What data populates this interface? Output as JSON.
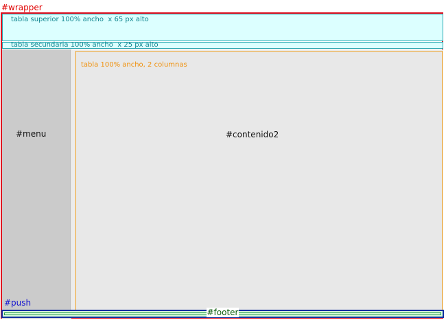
{
  "wrapper": {
    "label": "#wrapper"
  },
  "top_table": {
    "label": "tabla superior 100% ancho  x 65 px alto"
  },
  "secondary_table": {
    "label": "tabla secundaria 100% ancho  x 25 px alto"
  },
  "menu": {
    "label": "#menu"
  },
  "content": {
    "label": "#contenido2",
    "table_label": "tabla 100% ancho, 2 columnas"
  },
  "push": {
    "label": "#push"
  },
  "footer": {
    "label": "#footer"
  },
  "colors": {
    "wrapper": "#e01020",
    "table_border": "#2aa7b0",
    "table_fill": "#dcffff",
    "menu_fill": "#cbcbcb",
    "content_border": "#f0a020",
    "push": "#1010d0",
    "footer_border": "#1030a0",
    "footer_text": "#106010"
  }
}
